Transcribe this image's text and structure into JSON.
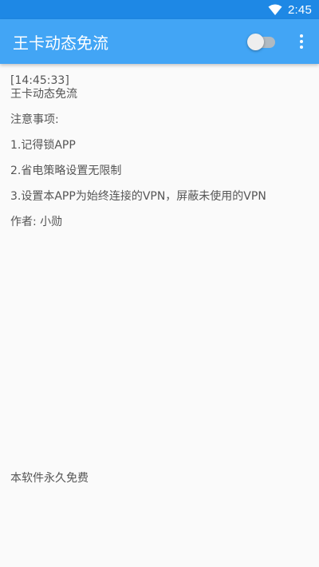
{
  "status_bar": {
    "time": "2:45",
    "icons": [
      "wifi-icon"
    ],
    "color": "#1e88e5"
  },
  "app_bar": {
    "title": "王卡动态免流",
    "switch_state": "off",
    "menu_icon": "more-vert-icon",
    "color": "#42a5f5"
  },
  "log": {
    "timestamp": "[14:45:33]",
    "lines": [
      "王卡动态免流",
      "注意事项:",
      "1.记得锁APP",
      "2.省电策略设置无限制",
      "3.设置本APP为始终连接的VPN，屏蔽未使用的VPN",
      "作者: 小勋"
    ]
  },
  "footer": {
    "text": "本软件永久免费"
  }
}
